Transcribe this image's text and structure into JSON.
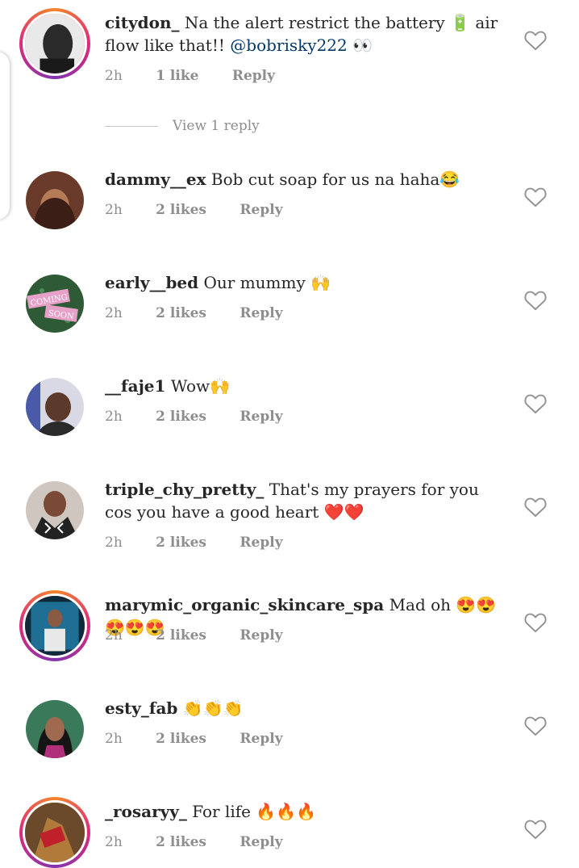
{
  "comments": [
    {
      "username": "citydon_",
      "text": "Na the alert restrict the battery 🔋 air flow like that!! ",
      "mention": "@bobrisky222",
      "suffix": " 👀",
      "time": "2h",
      "likes": "1 like",
      "reply": "Reply"
    },
    {
      "username": "dammy__ex",
      "text": "Bob cut soap for us na haha😂",
      "time": "2h",
      "likes": "2 likes",
      "reply": "Reply"
    },
    {
      "username": "early__bed",
      "text": "Our mummy 🙌",
      "time": "2h",
      "likes": "2 likes",
      "reply": "Reply"
    },
    {
      "username": "__faje1",
      "text": "Wow🙌",
      "time": "2h",
      "likes": "2 likes",
      "reply": "Reply"
    },
    {
      "username": "triple_chy_pretty_",
      "text": "That's my prayers for you cos you have a good heart ❤️❤️",
      "time": "2h",
      "likes": "2 likes",
      "reply": "Reply"
    },
    {
      "username": "marymic_organic_skincare_spa",
      "text": "Mad oh 😍😍😍😍😍",
      "time": "2h",
      "likes": "2 likes",
      "reply": "Reply"
    },
    {
      "username": "esty_fab",
      "text": "👏👏👏",
      "time": "2h",
      "likes": "2 likes",
      "reply": "Reply"
    },
    {
      "username": "_rosaryy_",
      "text": "For life 🔥🔥🔥",
      "time": "2h",
      "likes": "2 likes",
      "reply": "Reply"
    }
  ],
  "view_replies": "View 1 reply",
  "avatar_text": {
    "coming": "COMING",
    "soon": "SOON"
  }
}
